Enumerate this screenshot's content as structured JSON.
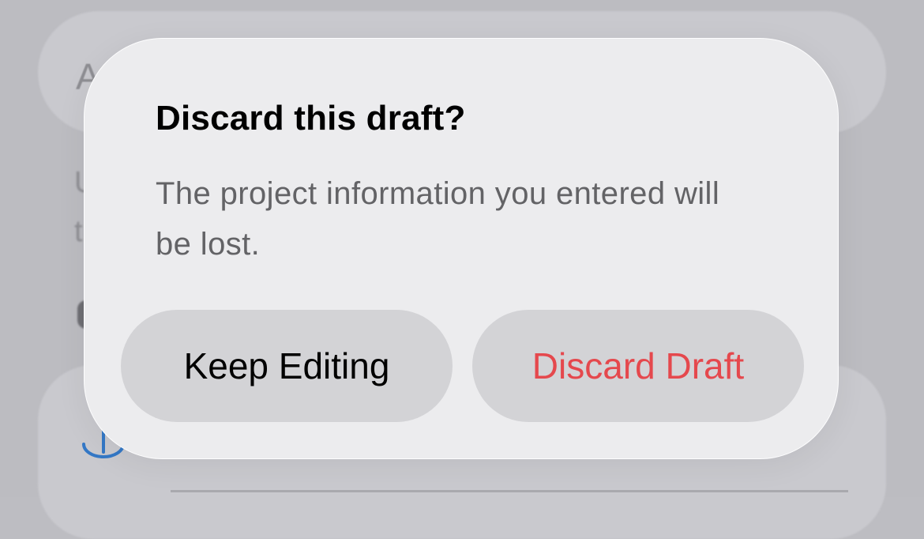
{
  "background": {
    "top_field_letter": "A",
    "side_fragments": [
      "U",
      "t"
    ]
  },
  "alert": {
    "title": "Discard this draft?",
    "message": "The project information you entered will be lost.",
    "buttons": {
      "keep_editing": "Keep Editing",
      "discard_draft": "Discard Draft"
    }
  },
  "colors": {
    "destructive": "#e5484d",
    "title": "#000000",
    "message": "#636366",
    "button_background": "#d3d3d6",
    "alert_background": "#ececee",
    "sync_icon": "#3478c6"
  },
  "icons": {
    "background_icon": "sync-icon"
  }
}
